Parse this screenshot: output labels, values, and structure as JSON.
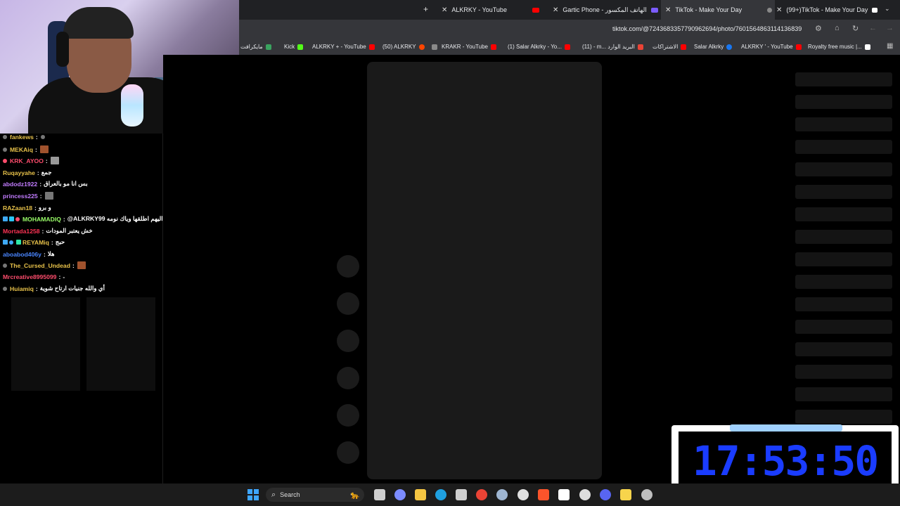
{
  "browser": {
    "tabs": [
      {
        "label": "ALKRKY - YouTube",
        "icon": "youtube-icon",
        "color": "#ff0000"
      },
      {
        "label": "Gartic Phone - الهاتف المكسور",
        "icon": "phone-icon",
        "color": "#7b5cff"
      },
      {
        "label": "TikTok - Make Your Day",
        "icon": "tiktok-icon",
        "color": "#888888"
      },
      {
        "label": "(99+)TikTok - Make Your Day",
        "icon": "tiktok-icon",
        "color": "#ffffff"
      }
    ],
    "new_tab": "+",
    "url": "tiktok.com/@7243683357790962694/photo/7601564863114136839",
    "bookmarks": [
      {
        "label": "مايكرافت",
        "color": "#3aa35f"
      },
      {
        "label": "Kick",
        "color": "#53fc18"
      },
      {
        "label": "ALKRKY + - YouTube",
        "color": "#ff0000"
      },
      {
        "label": "(50) ALKRKY",
        "color": "#ff4500"
      },
      {
        "label": "KRAKR - YouTube",
        "color": "#ff0000"
      },
      {
        "label": "(1) Salar Alkrky - Yo...",
        "color": "#ff0000"
      },
      {
        "label": "(11) - m... البريد الوارد",
        "color": "#ea4335"
      },
      {
        "label": "الاشتراكات",
        "color": "#ff0000"
      },
      {
        "label": "Salar Alkrky",
        "color": "#1877f2"
      },
      {
        "label": "ALKRKY ' - YouTube",
        "color": "#ff0000"
      },
      {
        "label": "Royalty free music |...",
        "color": "#ffffff"
      }
    ]
  },
  "chat": [
    {
      "user": "fankews",
      "color": "#e8c24a",
      "msg": ""
    },
    {
      "user": "MEKAiq",
      "color": "#e8c24a",
      "msg": ""
    },
    {
      "user": "KRK_AYOO",
      "color": "#ff4d6d",
      "msg": ""
    },
    {
      "user": "Ruqayyahe",
      "color": "#e8c24a",
      "msg": "جمع"
    },
    {
      "user": "abdodz1922",
      "color": "#c27cff",
      "msg": "بس انا مو بالعراق"
    },
    {
      "user": "princess225",
      "color": "#c27cff",
      "msg": ""
    },
    {
      "user": "RAZaan18",
      "color": "#e8c24a",
      "msg": "و برو"
    },
    {
      "user": "MOHAMADIQ",
      "color": "#9bff6a",
      "msg": "@ALKRKY99 اليهم اطلقها وياك نومه"
    },
    {
      "user": "Mortada1258",
      "color": "#ff3355",
      "msg": "خش يعتبر المودات"
    },
    {
      "user": "REYAMiq",
      "color": "#e8c24a",
      "msg": "حبج"
    },
    {
      "user": "aboabod406y",
      "color": "#4a86ff",
      "msg": "هلا"
    },
    {
      "user": "The_Cursed_Undead",
      "color": "#e8c24a",
      "msg": ""
    },
    {
      "user": "Mrcreative8995099",
      "color": "#ff4d6d",
      "msg": "-"
    },
    {
      "user": "Huiamiq",
      "color": "#e8c24a",
      "msg": "أي والله جنيات ارتاح شوية"
    }
  ],
  "clock": {
    "time": "17:53:50"
  },
  "taskbar": {
    "search_label": "Search",
    "apps": [
      {
        "name": "task-view-icon",
        "color": "#cfcfcf"
      },
      {
        "name": "copilot-icon",
        "color": "#7c8cff"
      },
      {
        "name": "file-explorer-icon",
        "color": "#f4c542"
      },
      {
        "name": "edge-icon",
        "color": "#1fa0e0"
      },
      {
        "name": "store-icon",
        "color": "#cfcfcf"
      },
      {
        "name": "chrome-icon",
        "color": "#ea4335"
      },
      {
        "name": "steam-icon",
        "color": "#9fb6d2"
      },
      {
        "name": "obs-icon",
        "color": "#e0e0e0"
      },
      {
        "name": "brave-icon",
        "color": "#fb542b"
      },
      {
        "name": "capcut-icon",
        "color": "#ffffff"
      },
      {
        "name": "settings-app-icon",
        "color": "#dddddd"
      },
      {
        "name": "discord-icon",
        "color": "#5865f2"
      },
      {
        "name": "notes-icon",
        "color": "#f7d44c"
      },
      {
        "name": "gear-icon",
        "color": "#bfbfbf"
      }
    ]
  }
}
